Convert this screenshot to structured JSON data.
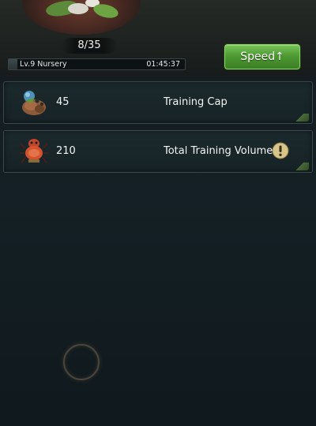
{
  "header": {
    "egg_count": "8/35",
    "building_label": "Lv.9 Nursery",
    "timer": "01:45:37",
    "progress": 0.05,
    "speed_button_label": "Speed↑"
  },
  "stats": [
    {
      "value": "45",
      "label": "Training Cap",
      "icon": "ant-colony-icon"
    },
    {
      "value": "210",
      "label": "Total Training Volume",
      "icon": "red-ant-icon"
    }
  ],
  "colors": {
    "speed_button": "#4e9a33",
    "row_border": "#3a4a4c",
    "alert": "#d8c58a"
  }
}
